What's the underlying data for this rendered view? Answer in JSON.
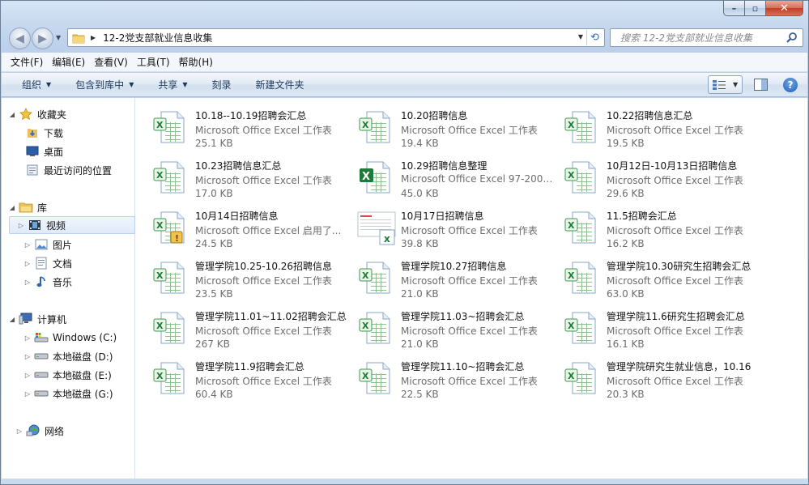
{
  "window": {
    "caption": {
      "minimize": "–",
      "maximize": "▫",
      "close": "✕"
    }
  },
  "address": {
    "path": "12-2党支部就业信息收集",
    "search_placeholder": "搜索 12-2党支部就业信息收集"
  },
  "menu": [
    "文件(F)",
    "编辑(E)",
    "查看(V)",
    "工具(T)",
    "帮助(H)"
  ],
  "commands": {
    "organize": "组织",
    "include_library": "包含到库中",
    "share": "共享",
    "burn": "刻录",
    "new_folder": "新建文件夹"
  },
  "sidebar": {
    "favorites": {
      "label": "收藏夹",
      "icon": "star-icon",
      "items": [
        {
          "label": "下载",
          "icon": "download-folder-icon"
        },
        {
          "label": "桌面",
          "icon": "desktop-icon"
        },
        {
          "label": "最近访问的位置",
          "icon": "recent-places-icon"
        }
      ]
    },
    "libraries": {
      "label": "库",
      "icon": "library-icon",
      "items": [
        {
          "label": "视频",
          "icon": "video-library-icon",
          "selected": true
        },
        {
          "label": "图片",
          "icon": "pictures-library-icon"
        },
        {
          "label": "文档",
          "icon": "documents-library-icon"
        },
        {
          "label": "音乐",
          "icon": "music-library-icon"
        }
      ]
    },
    "computer": {
      "label": "计算机",
      "icon": "computer-icon",
      "items": [
        {
          "label": "Windows  (C:)",
          "icon": "system-drive-icon"
        },
        {
          "label": "本地磁盘 (D:)",
          "icon": "drive-icon"
        },
        {
          "label": "本地磁盘 (E:)",
          "icon": "drive-icon"
        },
        {
          "label": "本地磁盘 (G:)",
          "icon": "drive-icon"
        }
      ]
    },
    "network": {
      "label": "网络",
      "icon": "network-icon"
    }
  },
  "files": [
    {
      "name": "10.18--10.19招聘会汇总",
      "type": "Microsoft Office Excel 工作表",
      "size": "25.1 KB",
      "icon": "excel-sheet-icon"
    },
    {
      "name": "10.20招聘信息",
      "type": "Microsoft Office Excel 工作表",
      "size": "19.4 KB",
      "icon": "excel-sheet-icon"
    },
    {
      "name": "10.22招聘信息汇总",
      "type": "Microsoft Office Excel 工作表",
      "size": "19.5 KB",
      "icon": "excel-sheet-icon"
    },
    {
      "name": "10.23招聘信息汇总",
      "type": "Microsoft Office Excel 工作表",
      "size": "17.0 KB",
      "icon": "excel-sheet-icon"
    },
    {
      "name": "10.29招聘信息整理",
      "type": "Microsoft Office Excel 97-2003...",
      "size": "45.0 KB",
      "icon": "excel-legacy-icon"
    },
    {
      "name": "10月12日-10月13日招聘信息",
      "type": "Microsoft Office Excel 工作表",
      "size": "29.6 KB",
      "icon": "excel-sheet-icon"
    },
    {
      "name": "10月14日招聘信息",
      "type": "Microsoft Office Excel 启用了...",
      "size": "24.5 KB",
      "icon": "excel-macro-icon"
    },
    {
      "name": "10月17日招聘信息",
      "type": "Microsoft Office Excel 工作表",
      "size": "39.8 KB",
      "icon": "excel-thumbnail-icon"
    },
    {
      "name": "11.5招聘会汇总",
      "type": "Microsoft Office Excel 工作表",
      "size": "16.2 KB",
      "icon": "excel-sheet-icon"
    },
    {
      "name": "管理学院10.25-10.26招聘信息",
      "type": "Microsoft Office Excel 工作表",
      "size": "23.5 KB",
      "icon": "excel-sheet-icon"
    },
    {
      "name": "管理学院10.27招聘信息",
      "type": "Microsoft Office Excel 工作表",
      "size": "21.0 KB",
      "icon": "excel-sheet-icon"
    },
    {
      "name": "管理学院10.30研究生招聘会汇总",
      "type": "Microsoft Office Excel 工作表",
      "size": "63.0 KB",
      "icon": "excel-sheet-icon"
    },
    {
      "name": "管理学院11.01~11.02招聘会汇总",
      "type": "Microsoft Office Excel 工作表",
      "size": "267 KB",
      "icon": "excel-sheet-icon"
    },
    {
      "name": "管理学院11.03~招聘会汇总",
      "type": "Microsoft Office Excel 工作表",
      "size": "21.0 KB",
      "icon": "excel-sheet-icon"
    },
    {
      "name": "管理学院11.6研究生招聘会汇总",
      "type": "Microsoft Office Excel 工作表",
      "size": "16.1 KB",
      "icon": "excel-sheet-icon"
    },
    {
      "name": "管理学院11.9招聘会汇总",
      "type": "Microsoft Office Excel 工作表",
      "size": "60.4 KB",
      "icon": "excel-sheet-icon"
    },
    {
      "name": "管理学院11.10~招聘会汇总",
      "type": "Microsoft Office Excel 工作表",
      "size": "22.5 KB",
      "icon": "excel-sheet-icon"
    },
    {
      "name": "管理学院研究生就业信息，10.16",
      "type": "Microsoft Office Excel 工作表",
      "size": "20.3 KB",
      "icon": "excel-sheet-icon"
    }
  ],
  "colors": {
    "accent": "#1e395b",
    "excel_green": "#1d7a3a",
    "selection": "#dfeaf9"
  }
}
